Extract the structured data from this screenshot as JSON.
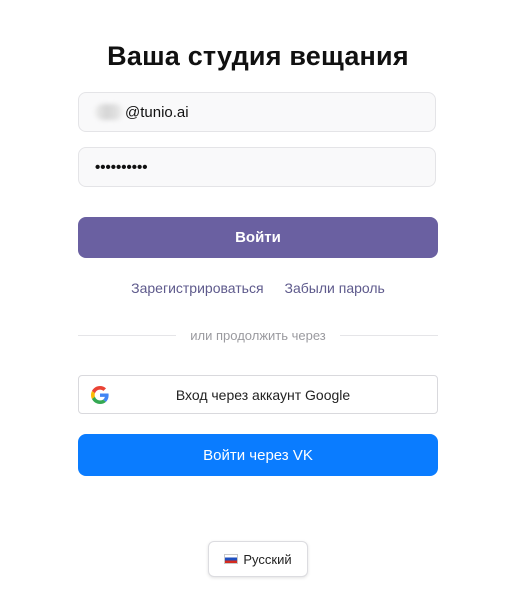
{
  "login": {
    "title": "Ваша студия вещания",
    "email_value": "@tunio.ai",
    "password_value": "••••••••••",
    "submit_label": "Войти",
    "register_link": "Зарегистрироваться",
    "forgot_link": "Забыли пароль",
    "divider_text": "или продолжить через",
    "google_label": "Вход через аккаунт Google",
    "vk_label": "Войти через VK"
  },
  "language": {
    "label": "Русский",
    "flag_icon": "russia-flag-icon"
  },
  "colors": {
    "primary": "#6a60a1",
    "vk_blue": "#0a7cff",
    "link": "#5e5a8c"
  }
}
